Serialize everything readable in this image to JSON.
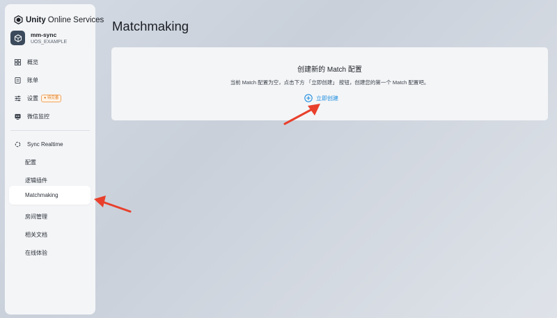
{
  "app": {
    "brand_bold": "Unity",
    "brand_light": "Online Services"
  },
  "project": {
    "name": "mm-sync",
    "id": "UOS_EXAMPLE"
  },
  "nav": {
    "overview": "概览",
    "billing": "账单",
    "settings": "设置",
    "settings_badge": "待完善",
    "wechat_monitor": "微信监控"
  },
  "service": {
    "name": "Sync Realtime",
    "items": [
      "配置",
      "逻辑插件",
      "Matchmaking",
      "房间管理",
      "相关文档",
      "在线体验"
    ],
    "active": "Matchmaking"
  },
  "main": {
    "title": "Matchmaking",
    "card_title": "创建新的 Match 配置",
    "card_desc": "当前 Match 配置为空，点击下方 「立即创建」 按钮，创建您的第一个 Match 配置吧。",
    "create_label": "立即创建"
  },
  "colors": {
    "accent": "#1f8fe0",
    "badge": "#e07a1f",
    "arrow": "#e8402c",
    "avatar": "#3b4a5c"
  }
}
